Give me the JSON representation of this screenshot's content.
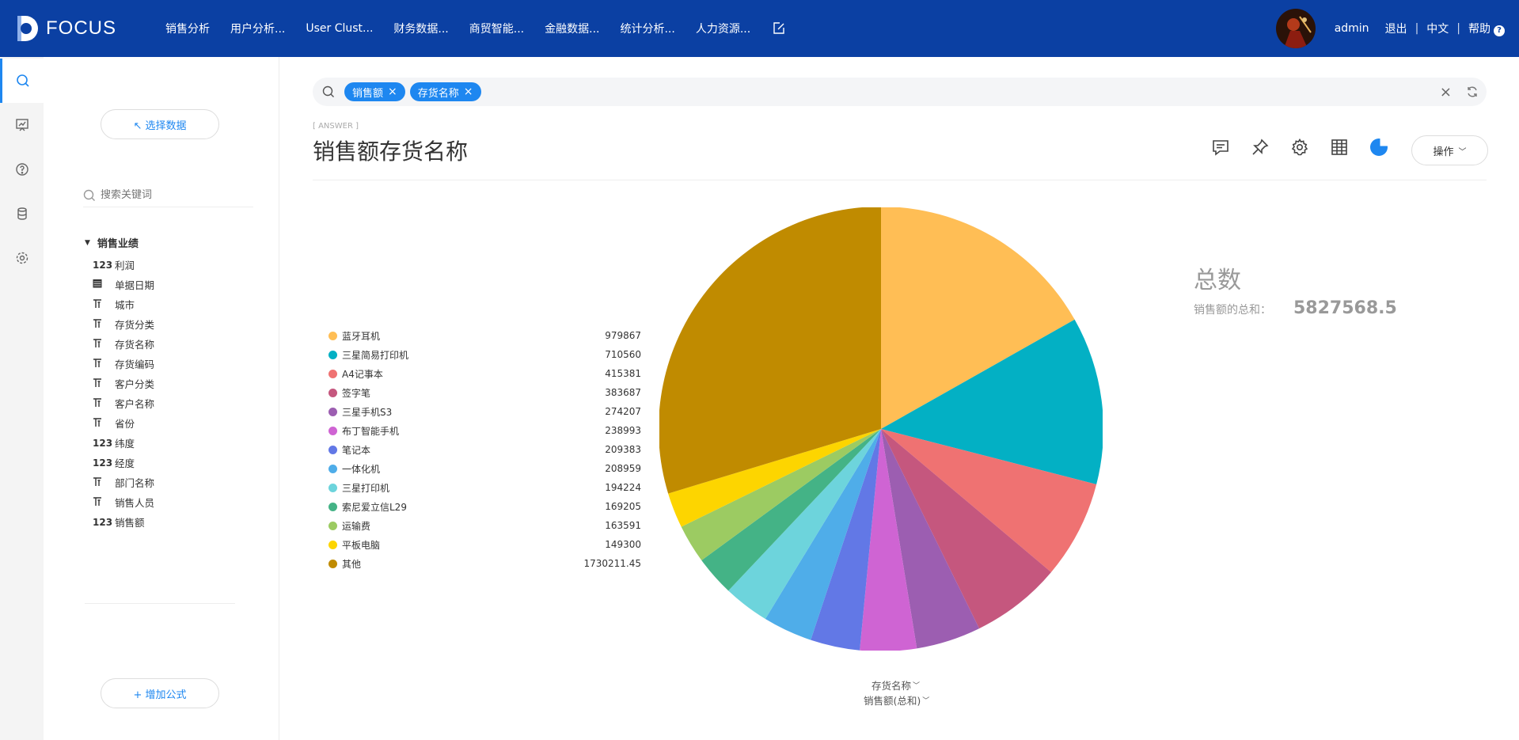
{
  "brand": {
    "name": "FOCUS"
  },
  "nav": {
    "items": [
      "销售分析",
      "用户分析...",
      "User Clust...",
      "财务数据...",
      "商贸智能...",
      "金融数据...",
      "统计分析...",
      "人力资源..."
    ]
  },
  "user": {
    "name": "admin",
    "logout": "退出",
    "language": "中文",
    "help": "帮助",
    "help_badge": "?"
  },
  "panel": {
    "select_data": "↖ 选择数据",
    "search_placeholder": "搜索关键词",
    "tree_title": "销售业绩",
    "fields": [
      {
        "type": "123",
        "name": "利润"
      },
      {
        "type": "date",
        "name": "单据日期"
      },
      {
        "type": "text",
        "name": "城市"
      },
      {
        "type": "text",
        "name": "存货分类"
      },
      {
        "type": "text",
        "name": "存货名称"
      },
      {
        "type": "text",
        "name": "存货编码"
      },
      {
        "type": "text",
        "name": "客户分类"
      },
      {
        "type": "text",
        "name": "客户名称"
      },
      {
        "type": "text",
        "name": "省份"
      },
      {
        "type": "123",
        "name": "纬度"
      },
      {
        "type": "123",
        "name": "经度"
      },
      {
        "type": "text",
        "name": "部门名称"
      },
      {
        "type": "text",
        "name": "销售人员"
      },
      {
        "type": "123",
        "name": "销售额"
      }
    ],
    "add_formula": "+ 增加公式"
  },
  "query": {
    "chips": [
      "销售额",
      "存货名称"
    ]
  },
  "answer": {
    "tag": "[ ANSWER ]",
    "title": "销售额存货名称",
    "operation_label": "操作"
  },
  "summary": {
    "title": "总数",
    "label": "销售额的总和：",
    "value": "5827568.5"
  },
  "axis": {
    "category_selector": "存货名称",
    "value_selector": "销售额(总和)"
  },
  "chart_data": {
    "type": "pie",
    "categories": [
      "蓝牙耳机",
      "三星简易打印机",
      "A4记事本",
      "签字笔",
      "三星手机S3",
      "布丁智能手机",
      "笔记本",
      "一体化机",
      "三星打印机",
      "索尼爱立信L29",
      "运输费",
      "平板电脑",
      "其他"
    ],
    "values": [
      979867,
      710560,
      415381,
      383687,
      274207,
      238993,
      209383,
      208959,
      194224,
      169205,
      163591,
      149300,
      1730211.45
    ],
    "value_labels": [
      "979867",
      "710560",
      "415381",
      "383687",
      "274207",
      "238993",
      "209383",
      "208959",
      "194224",
      "169205",
      "163591",
      "149300",
      "1730211.45"
    ],
    "colors": [
      "#ffbe55",
      "#03b0c4",
      "#ef7272",
      "#c5577e",
      "#9c5eb1",
      "#cf64d3",
      "#6278e6",
      "#4fade9",
      "#6dd4dc",
      "#44b386",
      "#9ccb62",
      "#fdd500",
      "#c08b00"
    ],
    "legend_position": "left"
  }
}
